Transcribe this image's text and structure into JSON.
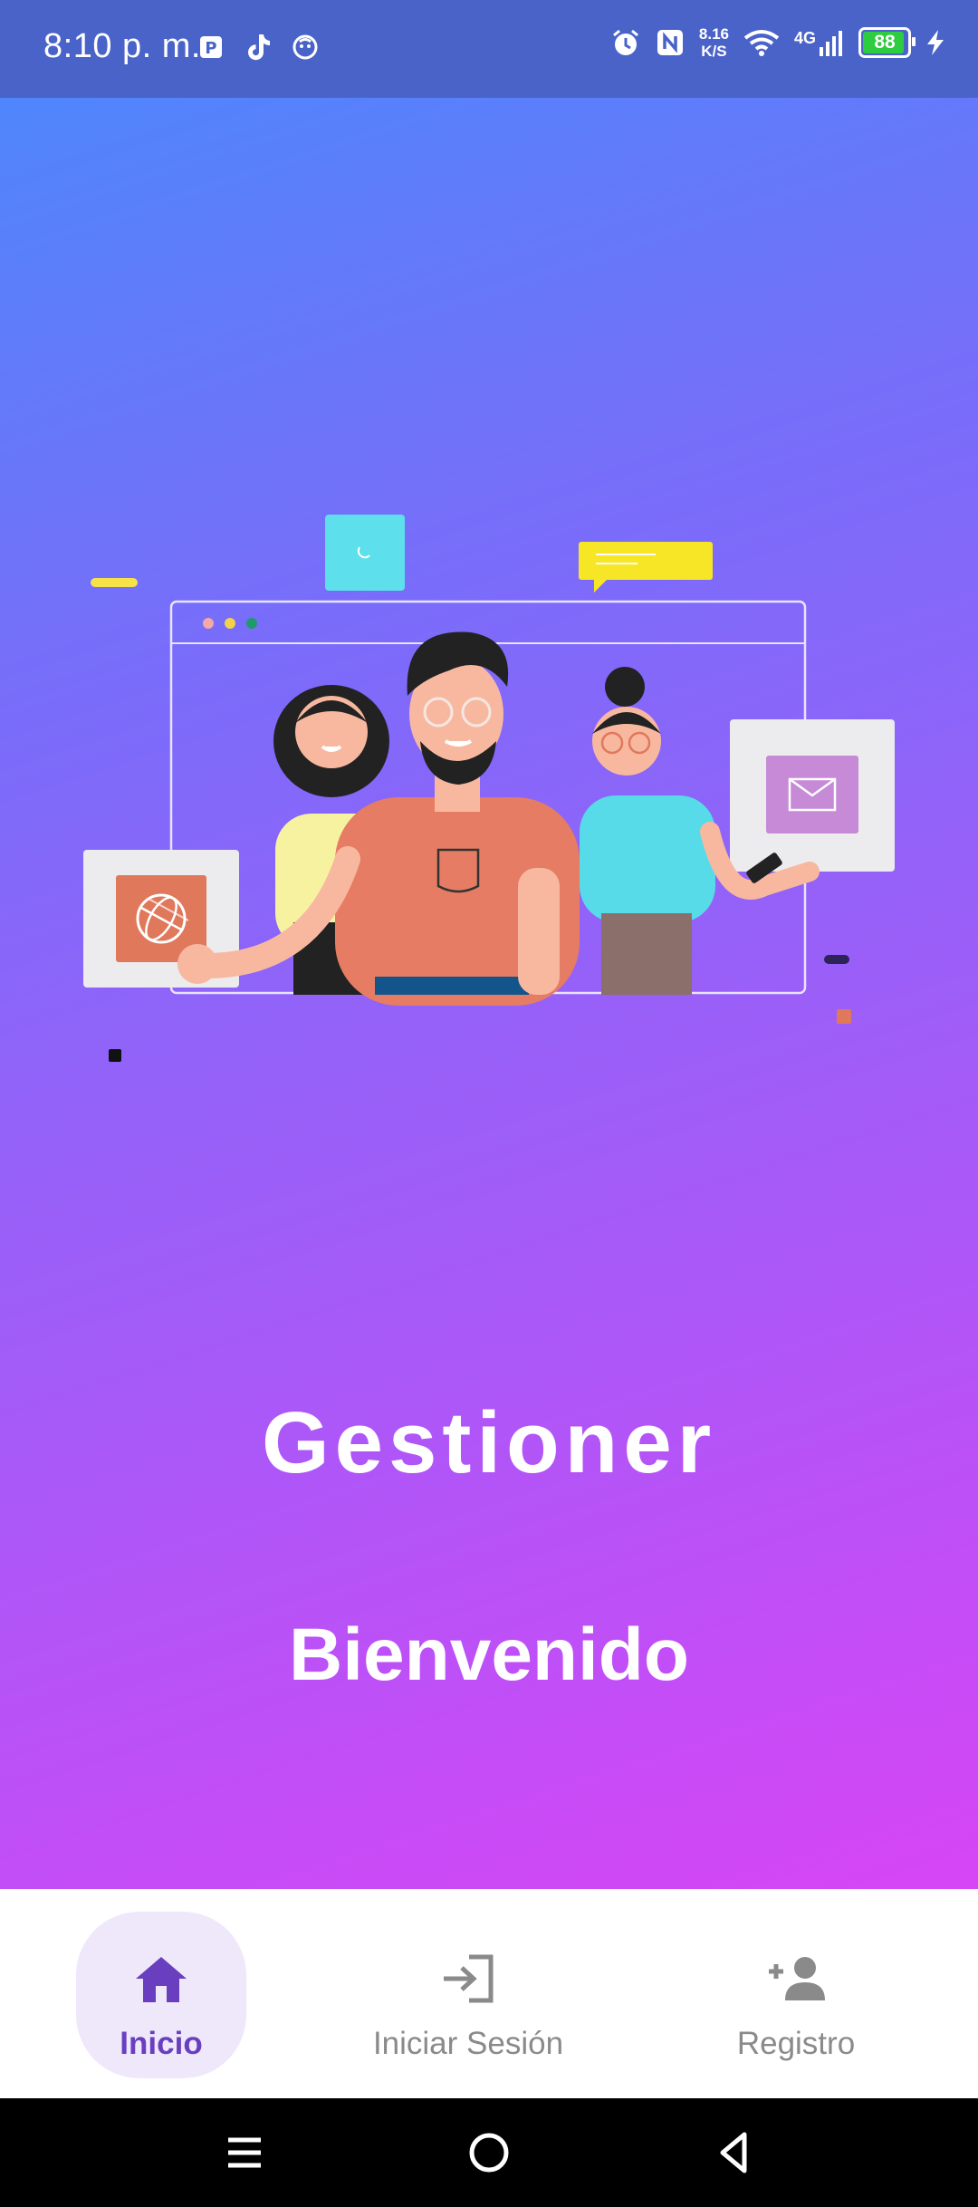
{
  "status_bar": {
    "time": "8:10 p. m.",
    "net_speed_value": "8.16",
    "net_speed_unit": "K/S",
    "network": "4G",
    "battery": "88",
    "color": "#4a63c9"
  },
  "hero": {
    "app_title": "Gestioner",
    "welcome": "Bienvenido",
    "gradient": [
      "#4f86fb",
      "#7a6cfa",
      "#a25cf8",
      "#d645f6"
    ]
  },
  "bottom_nav": {
    "items": [
      {
        "label": "Inicio",
        "icon": "home-icon",
        "active": true
      },
      {
        "label": "Iniciar Sesión",
        "icon": "login-icon",
        "active": false
      },
      {
        "label": "Registro",
        "icon": "add-person-icon",
        "active": false
      }
    ],
    "active_color": "#6a3fbf",
    "inactive_color": "#8a8a8a"
  },
  "system_nav": {
    "buttons": [
      "menu-icon",
      "home-circle-icon",
      "back-icon"
    ]
  }
}
